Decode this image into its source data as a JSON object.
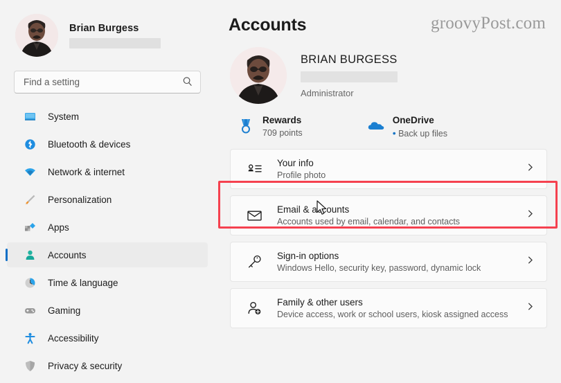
{
  "sidebar": {
    "profile": {
      "name": "Brian Burgess",
      "email_redacted": true
    },
    "search": {
      "placeholder": "Find a setting",
      "value": "",
      "icon": "search-icon"
    },
    "items": [
      {
        "label": "System",
        "icon": "monitor-icon",
        "selected": false
      },
      {
        "label": "Bluetooth & devices",
        "icon": "bluetooth-icon",
        "selected": false
      },
      {
        "label": "Network & internet",
        "icon": "wifi-icon",
        "selected": false
      },
      {
        "label": "Personalization",
        "icon": "paintbrush-icon",
        "selected": false
      },
      {
        "label": "Apps",
        "icon": "apps-icon",
        "selected": false
      },
      {
        "label": "Accounts",
        "icon": "person-icon",
        "selected": true
      },
      {
        "label": "Time & language",
        "icon": "clock-icon",
        "selected": false
      },
      {
        "label": "Gaming",
        "icon": "gamepad-icon",
        "selected": false
      },
      {
        "label": "Accessibility",
        "icon": "accessibility-icon",
        "selected": false
      },
      {
        "label": "Privacy & security",
        "icon": "shield-icon",
        "selected": false
      }
    ]
  },
  "main": {
    "title": "Accounts",
    "watermark": "groovyPost.com",
    "account": {
      "name": "BRIAN BURGESS",
      "email_redacted": true,
      "role": "Administrator"
    },
    "badges": [
      {
        "title": "Rewards",
        "subtitle": "709 points",
        "icon": "medal-icon",
        "bullet": false
      },
      {
        "title": "OneDrive",
        "subtitle": "Back up files",
        "icon": "cloud-icon",
        "bullet": true
      }
    ],
    "cards": [
      {
        "title": "Your info",
        "subtitle": "Profile photo",
        "icon": "contact-card-icon",
        "highlighted": true
      },
      {
        "title": "Email & accounts",
        "subtitle": "Accounts used by email, calendar, and contacts",
        "icon": "envelope-icon",
        "highlighted": false
      },
      {
        "title": "Sign-in options",
        "subtitle": "Windows Hello, security key, password, dynamic lock",
        "icon": "key-icon",
        "highlighted": false
      },
      {
        "title": "Family & other users",
        "subtitle": "Device access, work or school users, kiosk assigned access",
        "icon": "person-add-icon",
        "highlighted": false
      }
    ],
    "chevron_icon": "chevron-right-icon"
  },
  "annotation": {
    "highlight_color": "#f5414f",
    "cursor": "arrow-cursor"
  }
}
